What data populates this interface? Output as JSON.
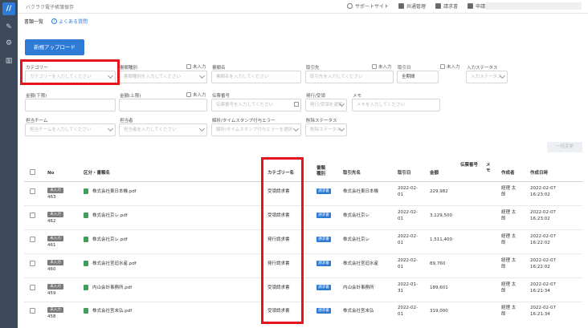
{
  "app_title": "バクラク電子帳簿保存",
  "topbar": {
    "links": [
      {
        "label": "サポートサイト",
        "icon": "help-circle-icon"
      },
      {
        "label": "共通管理",
        "icon": "grid-icon"
      },
      {
        "label": "請求書",
        "icon": "invoice-icon"
      },
      {
        "label": "申請",
        "icon": "application-icon"
      }
    ]
  },
  "breadcrumb": "書類一覧",
  "faq_label": "よくある質問",
  "upload_button": "新規アップロード",
  "filters": {
    "category": {
      "label": "カテゴリー",
      "placeholder": "カテゴリーを入力してください"
    },
    "doc_type": {
      "label": "書類種別",
      "placeholder": "書類種別を入力してください"
    },
    "doc_name": {
      "label": "書類名",
      "placeholder": "書類名を入力してください"
    },
    "partner": {
      "label": "取引先",
      "placeholder": "取引先を入力してください"
    },
    "trade_date": {
      "label": "取引日",
      "value": "全期間"
    },
    "input_status": {
      "label": "入力ステータス",
      "placeholder": "入力ステータス"
    },
    "amount_min": {
      "label": "金額(下限)"
    },
    "amount_max": {
      "label": "金額(上限)"
    },
    "slip_no": {
      "label": "伝票番号",
      "placeholder": "伝票番号を入力してください"
    },
    "issuer": {
      "label": "発行/受領",
      "placeholder": "発行/受領を選択"
    },
    "memo": {
      "label": "メモ",
      "placeholder": "メモを入力してください"
    },
    "team": {
      "label": "担当チーム",
      "placeholder": "担当チームを入力してください"
    },
    "person": {
      "label": "担当者",
      "placeholder": "担当者を入力してください"
    },
    "timestamp_err": {
      "label": "解析/タイムスタンプ付与エラー",
      "placeholder": "解析/タイムスタンプ付与エラーを選択"
    },
    "delete_status": {
      "label": "削除ステータス",
      "placeholder": "削除ステータス"
    },
    "uninput_label": "未入力"
  },
  "search_button": "一括変更",
  "table": {
    "headers": {
      "no": "No",
      "name": "区分・書類名",
      "category": "カテゴリー名",
      "doc_type": "書類種別",
      "partner": "取引先名",
      "date": "取引日",
      "amount": "金額",
      "slip": "伝票番号",
      "memo": "メモ",
      "creator": "作成者",
      "created": "作成日時"
    },
    "rows": [
      {
        "status": "未入力",
        "no": "463",
        "name": "株式会社東日本機.pdf",
        "category": "受領請求書",
        "doc_type": "請求書",
        "partner": "株式会社東日本機",
        "date": "2022-02-01",
        "amount": "229,982",
        "creator": "経理 太郎",
        "created": "2022-02-07 16:23:02"
      },
      {
        "status": "未入力",
        "no": "462",
        "name": "株式会社京レ.pdf",
        "category": "受領請求書",
        "doc_type": "請求書",
        "partner": "株式会社京レ",
        "date": "2022-02-01",
        "amount": "3,129,500",
        "creator": "経理 太郎",
        "created": "2022-02-07 16:23:02"
      },
      {
        "status": "未入力",
        "no": "461",
        "name": "株式会社京レ.pdf",
        "category": "発行請求書",
        "doc_type": "請求書",
        "partner": "株式会社京レ",
        "date": "2022-02-01",
        "amount": "1,511,400",
        "creator": "経理 太郎",
        "created": "2022-02-07 16:22:02"
      },
      {
        "status": "未入力",
        "no": "460",
        "name": "株式会社宮迫水産.pdf",
        "category": "発行請求書",
        "doc_type": "請求書",
        "partner": "株式会社宮迫水産",
        "date": "2022-02-01",
        "amount": "89,760",
        "creator": "経理 太郎",
        "created": "2022-02-07 16:22:02"
      },
      {
        "status": "未入力",
        "no": "459",
        "name": "内山会計事務所.pdf",
        "category": "受領請求書",
        "doc_type": "請求書",
        "partner": "内山会計事務所",
        "date": "2022-01-31",
        "amount": "189,601",
        "creator": "経理 太郎",
        "created": "2022-02-07 16:21:34"
      },
      {
        "status": "未入力",
        "no": "458",
        "name": "株式会社宮末弘.pdf",
        "category": "受領請求書",
        "doc_type": "請求書",
        "partner": "株式会社宮末弘",
        "date": "2022-02-01",
        "amount": "319,000",
        "creator": "経理 太郎",
        "created": "2022-02-07 16:21:34"
      }
    ]
  },
  "colors": {
    "accent": "#2e7bd6",
    "highlight": "#e8141c",
    "sidebar": "#3d4a5c",
    "file_icon": "#3f9e5a"
  }
}
